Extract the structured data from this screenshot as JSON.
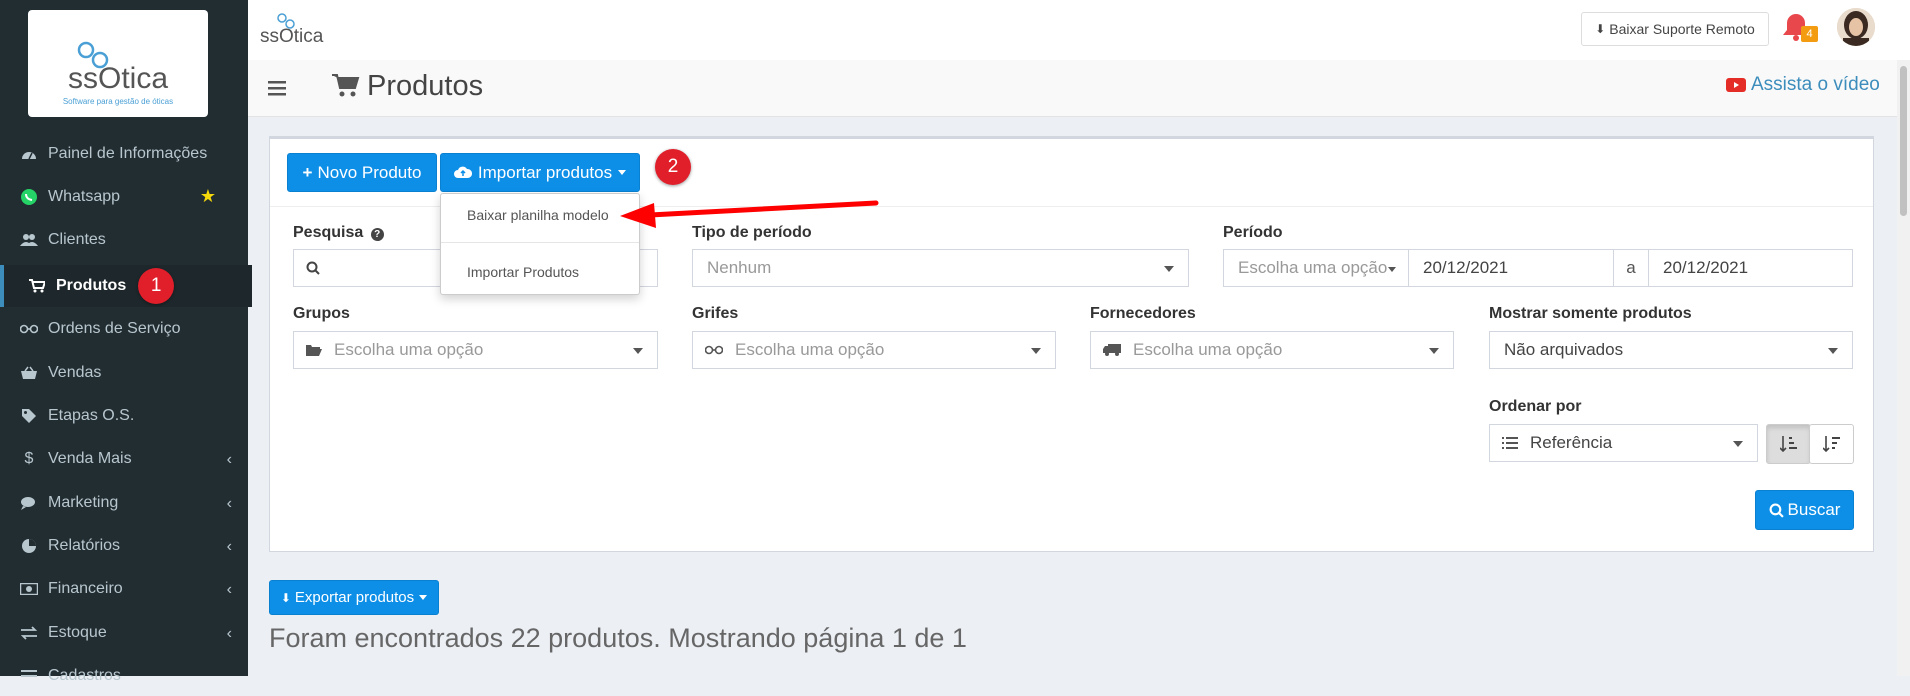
{
  "sidebar": {
    "logo_text": "ssOtica",
    "logo_tagline": "Software para gestão de óticas",
    "items": [
      {
        "label": "Painel de Informações",
        "icon": "dashboard-icon"
      },
      {
        "label": "Whatsapp",
        "icon": "whatsapp-icon"
      },
      {
        "label": "Clientes",
        "icon": "users-icon"
      },
      {
        "label": "Produtos",
        "icon": "cart-icon"
      },
      {
        "label": "Ordens de Serviço",
        "icon": "glasses-icon"
      },
      {
        "label": "Vendas",
        "icon": "basket-icon"
      },
      {
        "label": "Etapas O.S.",
        "icon": "tag-icon"
      },
      {
        "label": "Venda Mais",
        "icon": "dollar-icon"
      },
      {
        "label": "Marketing",
        "icon": "comments-icon"
      },
      {
        "label": "Relatórios",
        "icon": "pie-chart-icon"
      },
      {
        "label": "Financeiro",
        "icon": "money-icon"
      },
      {
        "label": "Estoque",
        "icon": "exchange-icon"
      },
      {
        "label": "Cadastros",
        "icon": "list-icon"
      }
    ],
    "produtos_step_badge": "1"
  },
  "topbar": {
    "brand": "ssOtica",
    "remote_support_label": "Baixar Suporte Remoto",
    "notification_count": "4"
  },
  "page": {
    "title": "Produtos",
    "video_link": "Assista o vídeo"
  },
  "toolbar": {
    "new_product_label": "Novo Produto",
    "import_label": "Importar produtos",
    "step_badge": "2",
    "import_menu": [
      "Baixar planilha modelo",
      "Importar Produtos"
    ]
  },
  "filters": {
    "pesquisa_label": "Pesquisa",
    "pesquisa_value": "",
    "tipo_periodo_label": "Tipo de período",
    "tipo_periodo_value": "Nenhum",
    "periodo_label": "Período",
    "periodo_option": "Escolha uma opção",
    "date_from": "20/12/2021",
    "date_sep": "a",
    "date_to": "20/12/2021",
    "grupos_label": "Grupos",
    "grupos_value": "Escolha uma opção",
    "grifes_label": "Grifes",
    "grifes_value": "Escolha uma opção",
    "fornecedores_label": "Fornecedores",
    "fornecedores_value": "Escolha uma opção",
    "mostrar_label": "Mostrar somente produtos",
    "mostrar_value": "Não arquivados",
    "ordenar_label": "Ordenar por",
    "ordenar_value": "Referência",
    "buscar_label": "Buscar"
  },
  "results": {
    "export_label": "Exportar produtos",
    "summary": "Foram encontrados 22 produtos. Mostrando página 1 de 1"
  },
  "colors": {
    "sidebar_bg": "#222d32",
    "primary_blue": "#0d8fe8",
    "badge_red": "#e01f2b",
    "arrow_red": "#ff0000"
  }
}
